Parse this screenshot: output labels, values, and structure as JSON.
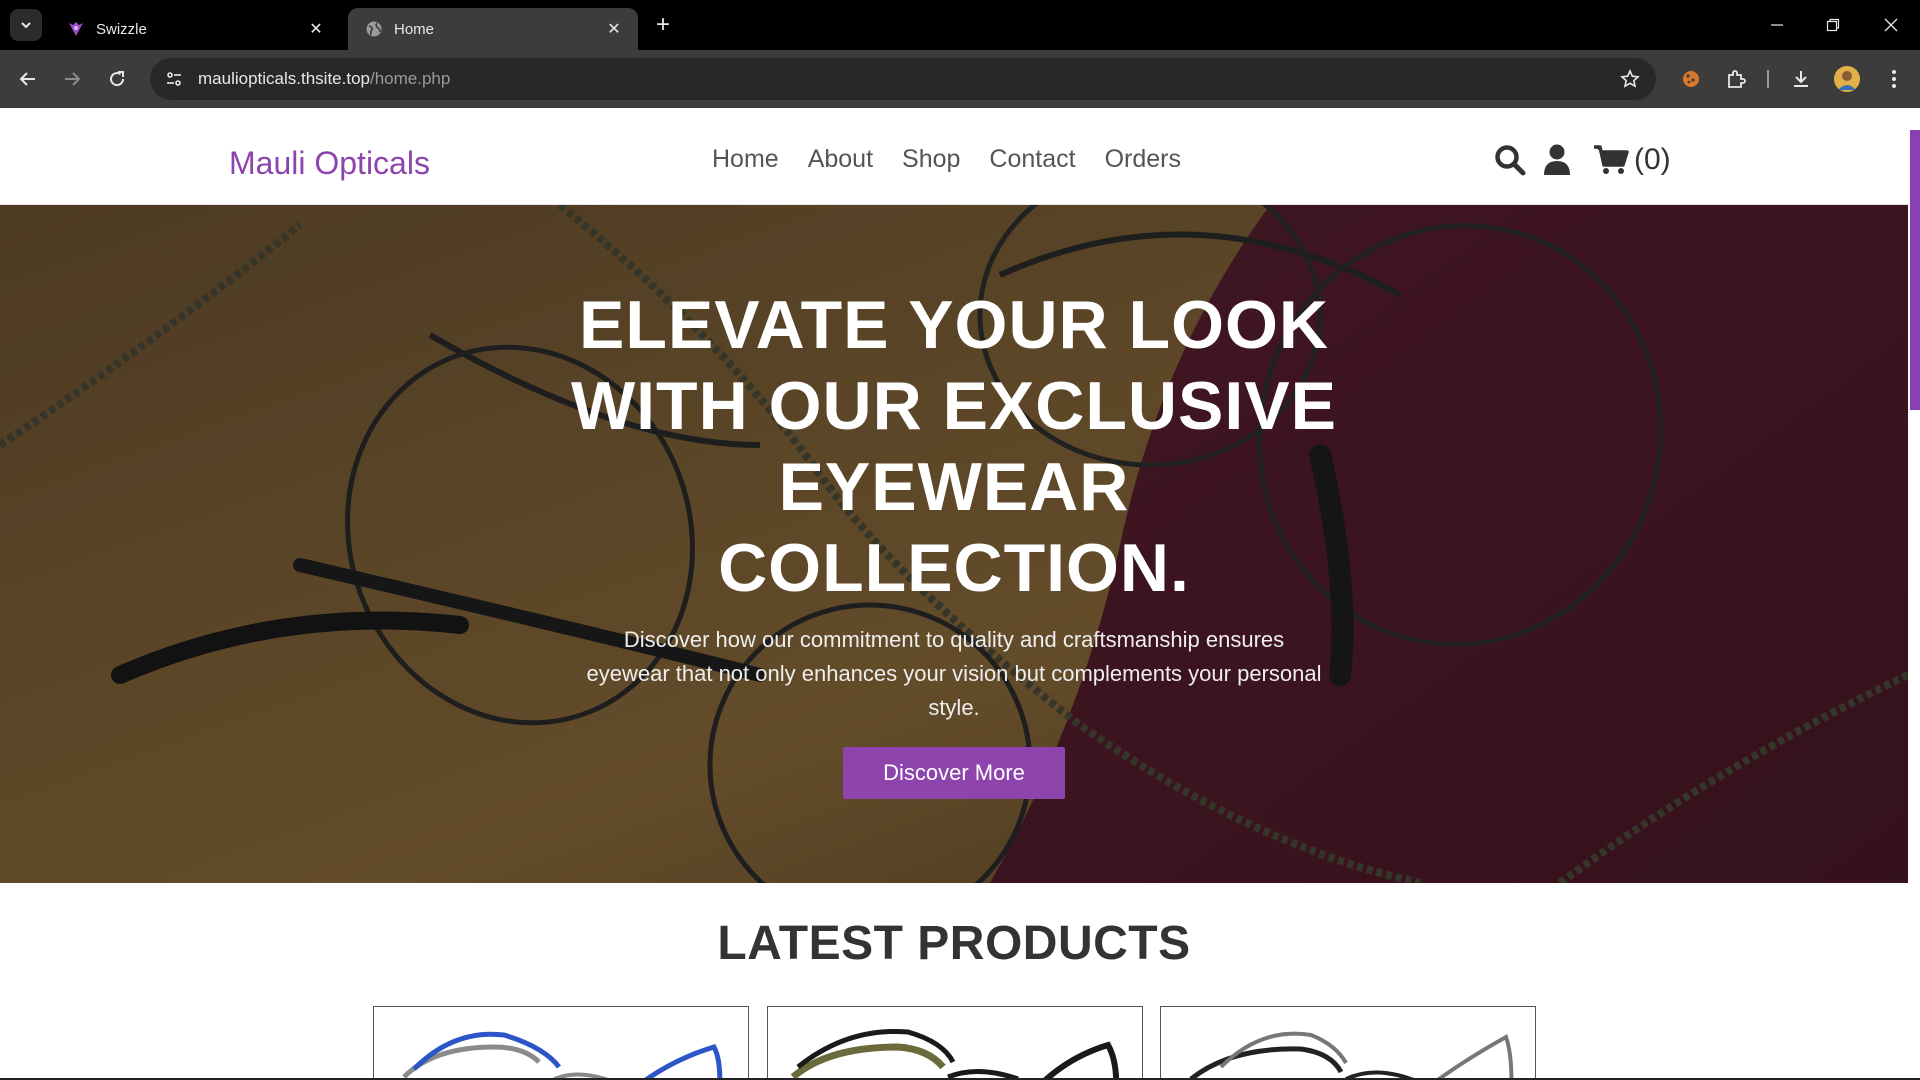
{
  "browser": {
    "tabs": [
      {
        "title": "Swizzle",
        "icon": "swizzle-icon",
        "active": false
      },
      {
        "title": "Home",
        "icon": "globe-icon",
        "active": true
      }
    ],
    "url_host": "mauliopticals.thsite.top",
    "url_path": "/home.php"
  },
  "site": {
    "brand": "Mauli Opticals",
    "menu": [
      "Home",
      "About",
      "Shop",
      "Contact",
      "Orders"
    ],
    "cart_count": "(0)",
    "accent_color": "#8e44ad"
  },
  "hero": {
    "title_lines": [
      "ELEVATE YOUR LOOK",
      "WITH OUR EXCLUSIVE",
      "EYEWEAR",
      "COLLECTION."
    ],
    "text": "Discover how our commitment to quality and craftsmanship ensures eyewear that not only enhances your vision but complements your personal style.",
    "button": "Discover More"
  },
  "products": {
    "title": "LATEST PRODUCTS",
    "cards": [
      {
        "frame_color": "#2c55c8"
      },
      {
        "frame_color": "#1a1a1a"
      },
      {
        "frame_color": "#222222"
      }
    ]
  }
}
